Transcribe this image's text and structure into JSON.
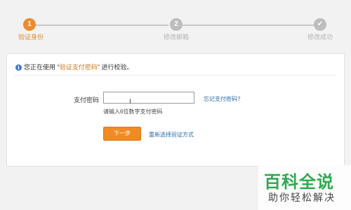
{
  "stepper": {
    "steps": [
      {
        "number": "1",
        "label": "验证身份",
        "state": "active"
      },
      {
        "number": "2",
        "label": "修改邮箱",
        "state": "pending"
      },
      {
        "number": "✔",
        "label": "修改成功",
        "state": "pending"
      }
    ],
    "colors": {
      "active": "#ec8b2f",
      "inactive": "#bdbdbd"
    }
  },
  "notice": {
    "icon": "info-icon",
    "prefix": "您正在使用 \"",
    "highlight": "验证支付密码",
    "suffix": "\" 进行校验。"
  },
  "form": {
    "label": "支付密码",
    "input_value": "",
    "forgot_link": "忘记支付密码?",
    "hint": "请输入6位数字支付密码",
    "next_button": "下一步",
    "reselect_link": "重新选择验证方式"
  },
  "watermark": {
    "title": "百科全说",
    "subtitle": "助你轻松解决"
  }
}
